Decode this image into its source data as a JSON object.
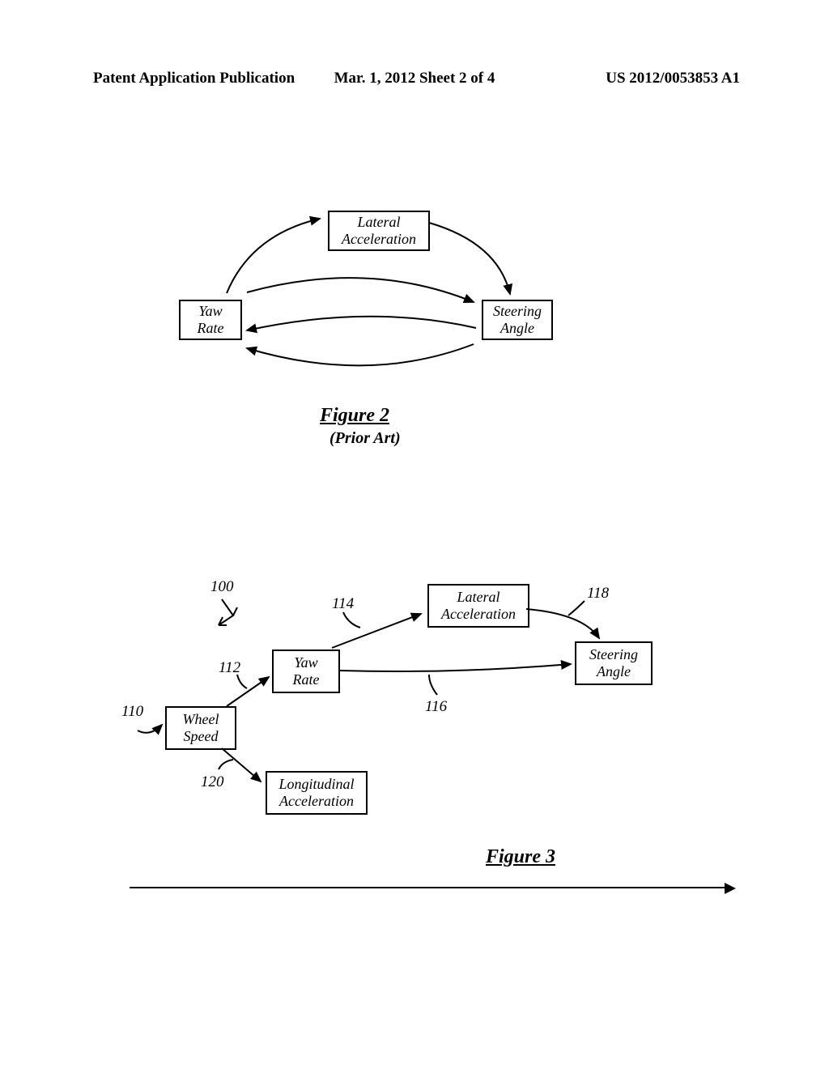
{
  "header": {
    "left": "Patent Application Publication",
    "center": "Mar. 1, 2012  Sheet 2 of 4",
    "right": "US 2012/0053853 A1"
  },
  "figure2": {
    "boxes": {
      "lateral_accel": "Lateral\nAcceleration",
      "yaw_rate": "Yaw\nRate",
      "steering_angle": "Steering\nAngle"
    },
    "label": "Figure 2",
    "sublabel": "(Prior Art)"
  },
  "figure3": {
    "boxes": {
      "wheel_speed": "Wheel\nSpeed",
      "yaw_rate": "Yaw\nRate",
      "lateral_accel": "Lateral\nAcceleration",
      "steering_angle": "Steering\nAngle",
      "long_accel": "Longitudinal\nAcceleration"
    },
    "refs": {
      "r100": "100",
      "r110": "110",
      "r112": "112",
      "r114": "114",
      "r116": "116",
      "r118": "118",
      "r120": "120"
    },
    "label": "Figure 3"
  }
}
